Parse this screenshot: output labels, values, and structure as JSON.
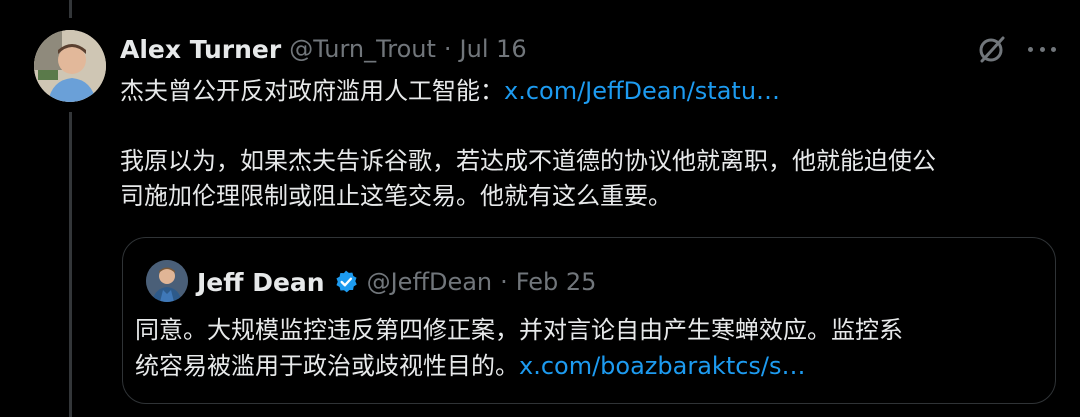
{
  "tweet": {
    "author_name": "Alex Turner",
    "handle": "@Turn_Trout",
    "separator": "·",
    "date": "Jul 16",
    "line1_text": "杰夫曾公开反对政府滥用人工智能：",
    "line1_link": "x.com/JeffDean/statu…",
    "line2": "我原以为，如果杰夫告诉谷歌，若达成不道德的协议他就离职，他就能迫使公",
    "line3": "司施加伦理限制或阻止这笔交易。他就有这么重要。"
  },
  "quote": {
    "author_name": "Jeff Dean",
    "handle": "@JeffDean",
    "separator": "·",
    "date": "Feb 25",
    "line1": "同意。大规模监控违反第四修正案，并对言论自由产生寒蝉效应。监控系",
    "line2_text": "统容易被滥用于政治或歧视性目的。",
    "line2_link": "x.com/boazbaraktcs/s…"
  },
  "icons": {
    "grok": "grok-icon",
    "more": "more-icon",
    "verified": "verified-badge-icon"
  },
  "colors": {
    "background": "#000000",
    "text": "#e7e9ea",
    "secondary": "#71767b",
    "link": "#1d9bf0",
    "border": "#2f3336"
  }
}
